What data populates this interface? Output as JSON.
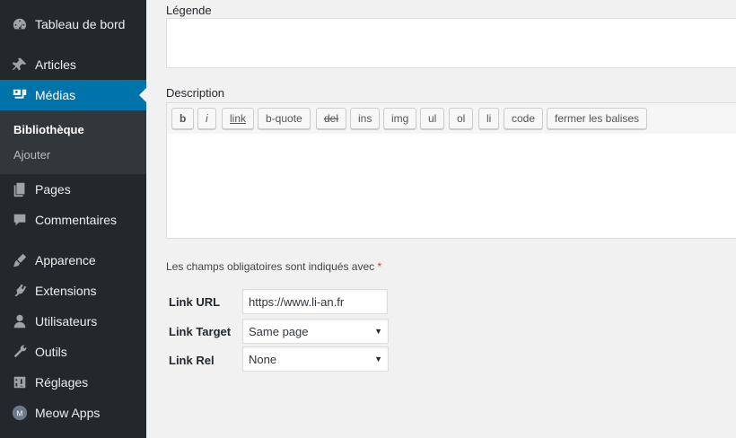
{
  "sidebar": {
    "items": [
      {
        "label": "Tableau de bord",
        "icon": "dashboard-icon"
      },
      {
        "label": "Articles",
        "icon": "pin-icon"
      },
      {
        "label": "Médias",
        "icon": "media-icon"
      },
      {
        "label": "Pages",
        "icon": "pages-icon"
      },
      {
        "label": "Commentaires",
        "icon": "comment-icon"
      },
      {
        "label": "Apparence",
        "icon": "brush-icon"
      },
      {
        "label": "Extensions",
        "icon": "plugin-icon"
      },
      {
        "label": "Utilisateurs",
        "icon": "user-icon"
      },
      {
        "label": "Outils",
        "icon": "wrench-icon"
      },
      {
        "label": "Réglages",
        "icon": "settings-icon"
      },
      {
        "label": "Meow Apps",
        "icon": "meow-apps-icon"
      }
    ],
    "submenu": [
      {
        "label": "Bibliothèque"
      },
      {
        "label": "Ajouter"
      }
    ],
    "accent_color": "#0073aa",
    "background_color": "#23282d"
  },
  "form": {
    "caption_label": "Légende",
    "description_label": "Description",
    "toolbar": [
      "b",
      "i",
      "link",
      "b-quote",
      "del",
      "ins",
      "img",
      "ul",
      "ol",
      "li",
      "code",
      "fermer les balises"
    ],
    "required_note": "Les champs obligatoires sont indiqués avec",
    "required_marker": "*",
    "link_url_label": "Link URL",
    "link_url_value": "https://www.li-an.fr",
    "link_target_label": "Link Target",
    "link_target_value": "Same page",
    "link_rel_label": "Link Rel",
    "link_rel_value": "None"
  }
}
